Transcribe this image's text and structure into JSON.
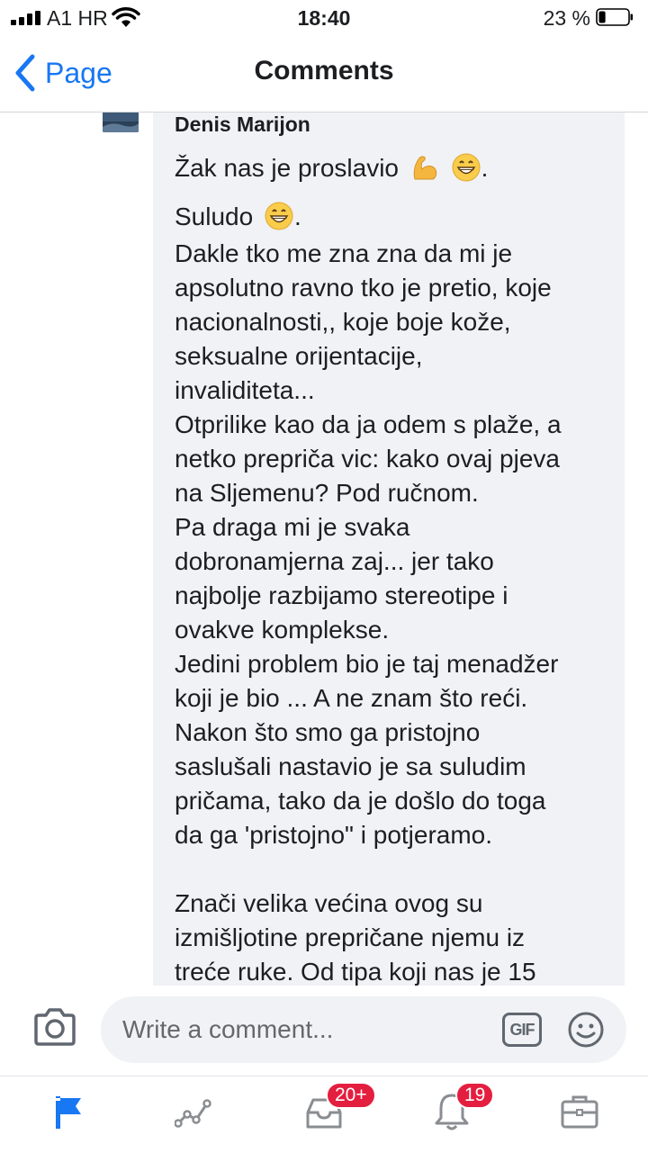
{
  "status_bar": {
    "carrier": "A1 HR",
    "time": "18:40",
    "battery_percent": "23 %",
    "battery_level": 0.23
  },
  "nav": {
    "back_label": "Page",
    "title": "Comments"
  },
  "comment": {
    "author": "Denis Marijon",
    "lines": [
      "Žak nas je proslavio",
      "Suludo",
      "Dakle tko me zna zna da mi je",
      "apsolutno ravno tko je pretio, koje",
      "nacionalnosti,, koje boje kože,",
      "seksualne orijentacije,",
      "invaliditeta...",
      "Otprilike kao da ja odem s plaže, a",
      "netko prepriča vic: kako ovaj pjeva",
      "na Sljemenu? Pod ručnom.",
      "Pa draga mi je svaka",
      "dobronamjerna zaj... jer tako",
      "najbolje razbijamo stereotipe i",
      "ovakve komplekse.",
      "Jedini problem bio je taj menadžer",
      "koji je bio ... A ne znam što reći.",
      "Nakon što smo ga pristojno",
      "saslušali nastavio je sa suludim",
      "pričama, tako da je došlo do toga",
      "da ga 'pristojno\" i potjeramo.",
      "Znači velika većina ovog su",
      "izmišljotine prepričane njemu iz",
      "treće ruke. Od tipa koji nas je 15"
    ],
    "punctuation_after_emoji": ".",
    "emojis": [
      "flexed-biceps-icon",
      "grinning-face-icon"
    ]
  },
  "composer": {
    "placeholder": "Write a comment...",
    "gif_label": "GIF"
  },
  "tabs": [
    {
      "name": "pages",
      "icon": "flag-icon",
      "active": true
    },
    {
      "name": "insights",
      "icon": "chart-icon"
    },
    {
      "name": "inbox",
      "icon": "inbox-icon",
      "badge": "20+"
    },
    {
      "name": "notifications",
      "icon": "bell-icon",
      "badge": "19"
    },
    {
      "name": "tools",
      "icon": "briefcase-icon"
    }
  ],
  "colors": {
    "accent": "#1877f2",
    "badge": "#e41e3f",
    "bubble": "#f0f2f5"
  }
}
